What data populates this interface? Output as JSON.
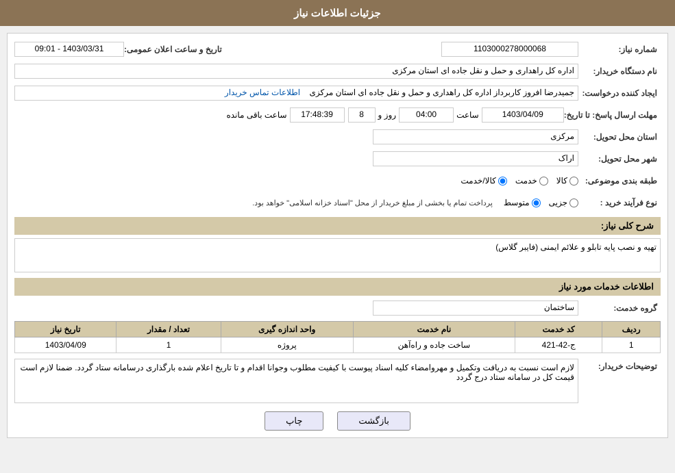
{
  "header": {
    "title": "جزئیات اطلاعات نیاز"
  },
  "fields": {
    "need_number_label": "شماره نیاز:",
    "need_number_value": "1103000278000068",
    "date_label": "تاریخ و ساعت اعلان عمومی:",
    "date_value": "1403/03/31 - 09:01",
    "buyer_org_label": "نام دستگاه خریدار:",
    "buyer_org_value": "اداره کل راهداری و حمل و نقل جاده ای استان مرکزی",
    "creator_label": "ایجاد کننده درخواست:",
    "creator_value": "جمیدرضا  افروز  کاربرداز اداره کل راهداری و حمل و نقل جاده ای استان مرکزی",
    "contact_link": "اطلاعات تماس خریدار",
    "response_date_label": "مهلت ارسال پاسخ: تا تاریخ:",
    "response_date": "1403/04/09",
    "response_time_label": "ساعت",
    "response_time": "04:00",
    "response_day_label": "روز و",
    "response_days": "8",
    "response_remaining_label": "ساعت باقی مانده",
    "response_remaining": "17:48:39",
    "province_label": "استان محل تحویل:",
    "province_value": "مرکزی",
    "city_label": "شهر محل تحویل:",
    "city_value": "اراک",
    "category_label": "طبقه بندی موضوعی:",
    "category_kala": "کالا",
    "category_khadamat": "خدمت",
    "category_kala_khadamat": "کالا/خدمت",
    "process_type_label": "نوع فرآیند خرید :",
    "process_jozee": "جزیی",
    "process_motavaset": "متوسط",
    "process_note": "پرداخت تمام یا بخشی از مبلغ خریدار از محل \"اسناد خزانه اسلامی\" خواهد بود.",
    "need_description_label": "شرح کلی نیاز:",
    "need_description": "تهیه و نصب پایه تابلو و علائم ایمنی (فایبر گلاس)",
    "services_section_label": "اطلاعات خدمات مورد نیاز",
    "service_group_label": "گروه خدمت:",
    "service_group_value": "ساختمان",
    "table": {
      "headers": [
        "ردیف",
        "کد خدمت",
        "نام خدمت",
        "واحد اندازه گیری",
        "تعداد / مقدار",
        "تاریخ نیاز"
      ],
      "rows": [
        {
          "row": "1",
          "code": "ج-42-421",
          "name": "ساخت جاده و راه‌آهن",
          "unit": "پروژه",
          "quantity": "1",
          "date": "1403/04/09"
        }
      ]
    },
    "buyer_notes_label": "توضیحات خریدار:",
    "buyer_notes": "لازم است نسبت به دریافت وتکمیل و مهروامضاء کلیه اسناد پیوست با کیفیت مطلوب وجوانا اقدام و تا تاریخ اعلام شده بارگذاری درسامانه ستاد گردد. ضمنا لازم است قیمت کل در سامانه ستاد درج گردد"
  },
  "buttons": {
    "back_label": "بازگشت",
    "print_label": "چاپ"
  }
}
